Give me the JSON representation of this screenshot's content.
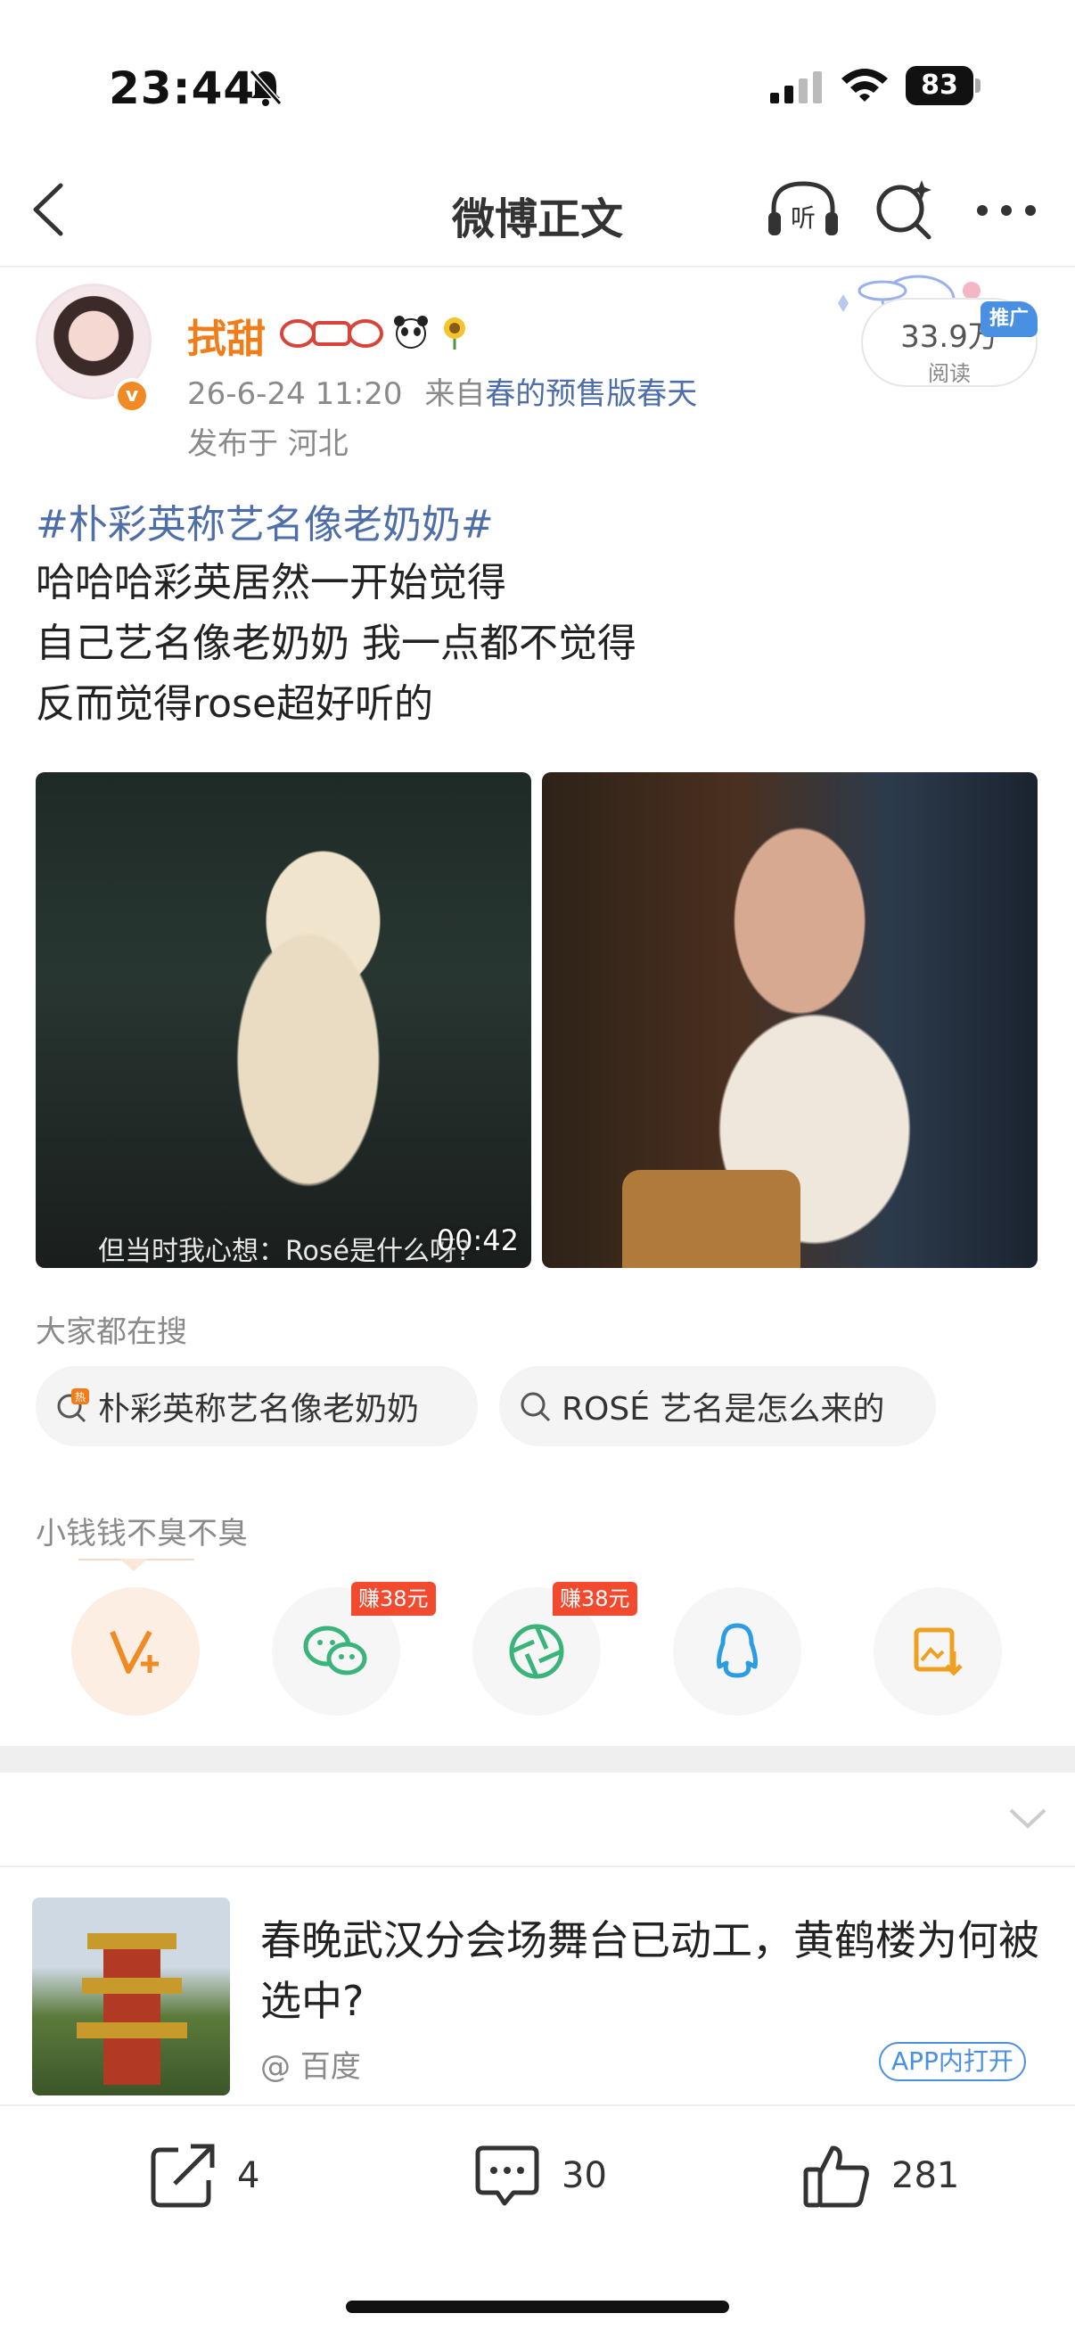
{
  "status": {
    "time": "23:44",
    "battery": "83"
  },
  "nav": {
    "title": "微博正文"
  },
  "post": {
    "username": "拭甜",
    "timestamp": "26-6-24 11:20",
    "from_prefix": "来自",
    "source": "春的预售版春天",
    "location": "发布于 河北",
    "reads": "33.9万",
    "reads_label": "阅读",
    "promo": "推广",
    "hashtag": "#朴彩英称艺名像老奶奶#",
    "lines": [
      "哈哈哈彩英居然一开始觉得",
      "自己艺名像老奶奶 我一点都不觉得",
      "反而觉得rose超好听的"
    ],
    "video_duration": "00:42",
    "video_subtitle": "但当时我心想：Rosé是什么呀?"
  },
  "search": {
    "label": "大家都在搜",
    "chips": [
      "朴彩英称艺名像老奶奶",
      "ROSÉ 艺名是怎么来的"
    ]
  },
  "share": {
    "user": "小钱钱不臭不臭",
    "earn1": "赚38元",
    "earn2": "赚38元"
  },
  "ad": {
    "title": "春晚武汉分会场舞台已动工，黄鹤楼为何被选中?",
    "source": "@ 百度",
    "open": "APP内打开"
  },
  "actions": {
    "repost": "4",
    "comment": "30",
    "like": "281"
  },
  "colors": {
    "accent_orange": "#f07d18",
    "link_blue": "#4e6ea9",
    "earn_red": "#f24a2e"
  }
}
